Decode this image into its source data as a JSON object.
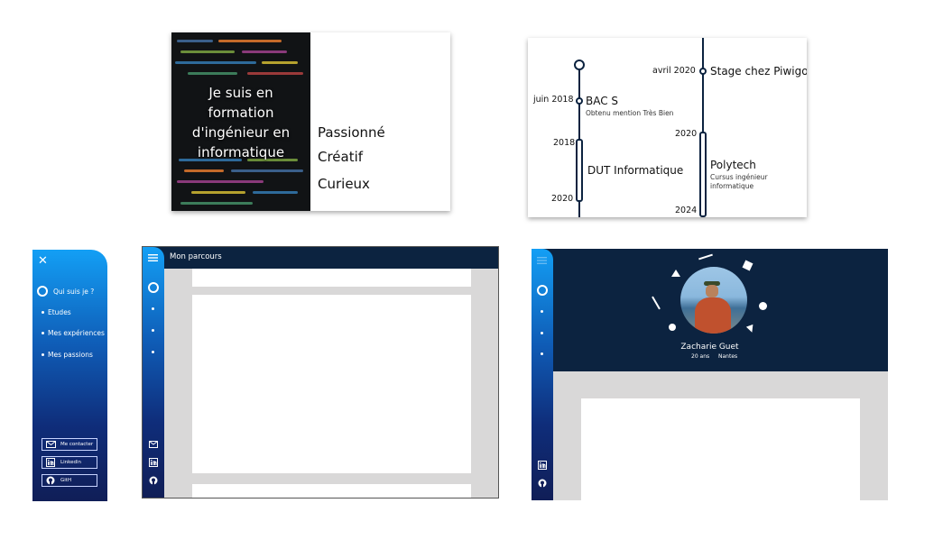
{
  "card1": {
    "headline": "Je suis en formation d'ingénieur en informatique",
    "traits": [
      "Passionné",
      "Créatif",
      "Curieux"
    ]
  },
  "timeline": {
    "left": [
      {
        "date": "juin 2018",
        "label": "BAC S",
        "sub": "Obtenu mention Très Bien"
      },
      {
        "start": "2018",
        "end": "2020",
        "label": "DUT Informatique"
      }
    ],
    "right": [
      {
        "date": "avril 2020",
        "label": "Stage chez Piwigo"
      },
      {
        "start": "2020",
        "end": "2024",
        "label": "Polytech",
        "sub1": "Cursus ingénieur",
        "sub2": "informatique"
      }
    ]
  },
  "sidebar": {
    "close_icon": "close-icon",
    "items": [
      {
        "label": "Qui suis je ?",
        "active": true
      },
      {
        "label": "Etudes"
      },
      {
        "label": "Mes expériences"
      },
      {
        "label": "Mes passions"
      }
    ],
    "buttons": [
      {
        "label": "Me contacter",
        "icon": "mail-icon"
      },
      {
        "label": "Linkedin",
        "icon": "linkedin-icon"
      },
      {
        "label": "GitH",
        "icon": "github-icon"
      }
    ]
  },
  "parcours": {
    "header_title": "Mon parcours",
    "menu_icon": "hamburger-icon"
  },
  "profile": {
    "name": "Zacharie Guet",
    "age": "20 ans",
    "city": "Nantes"
  },
  "colors": {
    "navy": "#0c2340",
    "gradient_top": "#139ff5",
    "gradient_bottom": "#101e57",
    "panel_gray": "#d9d8d8"
  }
}
